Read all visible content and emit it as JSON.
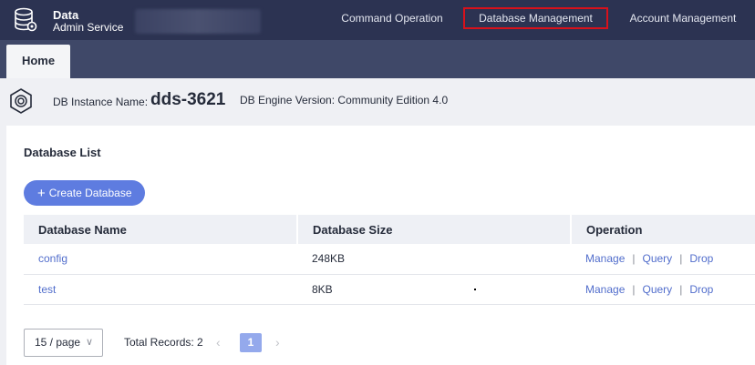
{
  "brand": {
    "line1": "Data",
    "line2": "Admin Service",
    "icon": "database-icon"
  },
  "nav": [
    {
      "label": "Command Operation"
    },
    {
      "label": "Database Management",
      "active": true
    },
    {
      "label": "Account Management"
    }
  ],
  "tabs": [
    {
      "label": "Home"
    }
  ],
  "instance": {
    "name_label": "DB Instance Name:",
    "name": "dds-3621",
    "engine": "DB Engine Version: Community Edition 4.0",
    "icon": "instance-icon"
  },
  "panel": {
    "title": "Database List",
    "create_button": "Create Database"
  },
  "table": {
    "columns": [
      "Database Name",
      "Database Size",
      "Operation"
    ],
    "rows": [
      {
        "name": "config",
        "size": "248KB",
        "actions": [
          "Manage",
          "Query",
          "Drop"
        ]
      },
      {
        "name": "test",
        "size": "8KB",
        "actions": [
          "Manage",
          "Query",
          "Drop"
        ]
      }
    ]
  },
  "pagination": {
    "page_size": "15 / page",
    "total": "Total Records: 2",
    "current_page": "1"
  },
  "colors": {
    "nav_bg": "#2c3352",
    "tab_bg": "#3f4868",
    "accent": "#5e7ce0",
    "link": "#526ecc",
    "highlight": "#d8111b"
  }
}
